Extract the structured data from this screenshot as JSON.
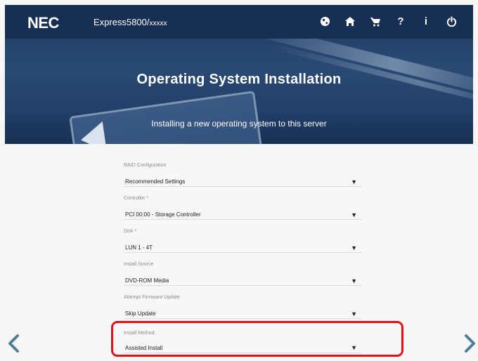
{
  "header": {
    "brand": "NEC",
    "product": "Express5800/",
    "product_model": "xxxxx",
    "icons": [
      "globe-icon",
      "home-icon",
      "cart-icon",
      "help-icon",
      "info-icon",
      "power-icon"
    ],
    "icon_glyphs": [
      "",
      "",
      "",
      "?",
      "i",
      ""
    ]
  },
  "hero": {
    "title": "Operating System Installation",
    "subtitle": "Installing a new operating system to this server"
  },
  "form": {
    "fields": [
      {
        "label": "RAID Configuration",
        "value": "Recommended Settings"
      },
      {
        "label": "Controller *",
        "value": "PCI 00:00 - Storage Controller"
      },
      {
        "label": "Disk *",
        "value": "LUN 1 - 4T"
      },
      {
        "label": "Install Source",
        "value": "DVD-ROM Media"
      },
      {
        "label": "Attempt Firmware Update",
        "value": "Skip Update"
      },
      {
        "label": "Install Method:",
        "value": "Assisted Install"
      }
    ]
  },
  "colors": {
    "header_bg": "#162f52",
    "page_bg": "#f7f7f7",
    "highlight": "#e2101b",
    "arrow": "#4f7f97"
  }
}
